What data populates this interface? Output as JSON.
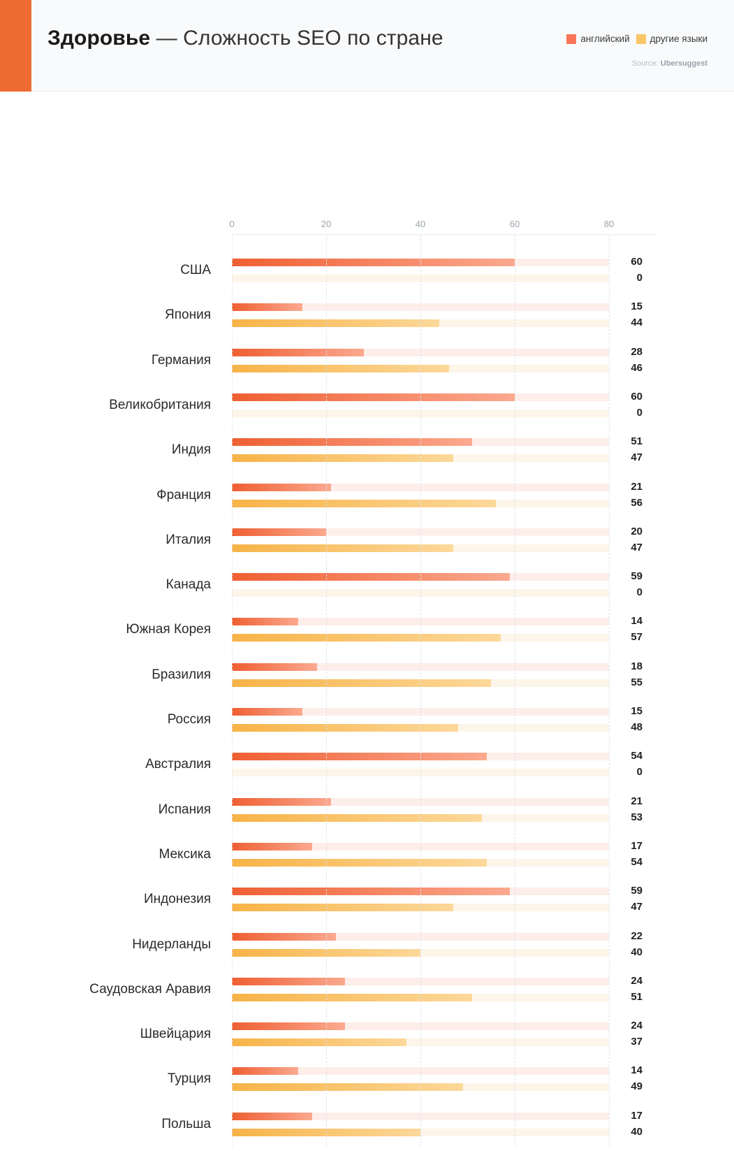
{
  "header": {
    "title_category": "Здоровье",
    "title_rest": " — Сложность SEO по стране",
    "legend": [
      {
        "label": "английский",
        "color": "#f8755a",
        "key": "en"
      },
      {
        "label": "другие языки",
        "color": "#fbc56a",
        "key": "other"
      }
    ],
    "source_prefix": "Source: ",
    "source_name": "Ubersuggest"
  },
  "chart_data": {
    "type": "bar",
    "orientation": "horizontal",
    "title": "Здоровье — Сложность SEO по стране",
    "xlabel": "",
    "ylabel": "",
    "xlim": [
      0,
      80
    ],
    "ticks": [
      0,
      20,
      40,
      60,
      80
    ],
    "tick_labels": [
      "0",
      "20",
      "40",
      "60",
      "80"
    ],
    "grid": true,
    "legend_position": "top-right",
    "source": "Ubersuggest",
    "categories": [
      "США",
      "Япония",
      "Германия",
      "Великобритания",
      "Индия",
      "Франция",
      "Италия",
      "Канада",
      "Южная Корея",
      "Бразилия",
      "Россия",
      "Австралия",
      "Испания",
      "Мексика",
      "Индонезия",
      "Нидерланды",
      "Саудовская Аравия",
      "Швейцария",
      "Турция",
      "Польша"
    ],
    "series": [
      {
        "name": "английский",
        "color": "#ef5f32",
        "values": [
          60,
          15,
          28,
          60,
          51,
          21,
          20,
          59,
          14,
          18,
          15,
          54,
          21,
          17,
          59,
          22,
          24,
          24,
          14,
          17
        ]
      },
      {
        "name": "другие языки",
        "color": "#f7b347",
        "values": [
          0,
          44,
          46,
          0,
          47,
          56,
          47,
          0,
          57,
          55,
          48,
          0,
          53,
          54,
          47,
          40,
          51,
          37,
          49,
          40
        ]
      }
    ]
  }
}
